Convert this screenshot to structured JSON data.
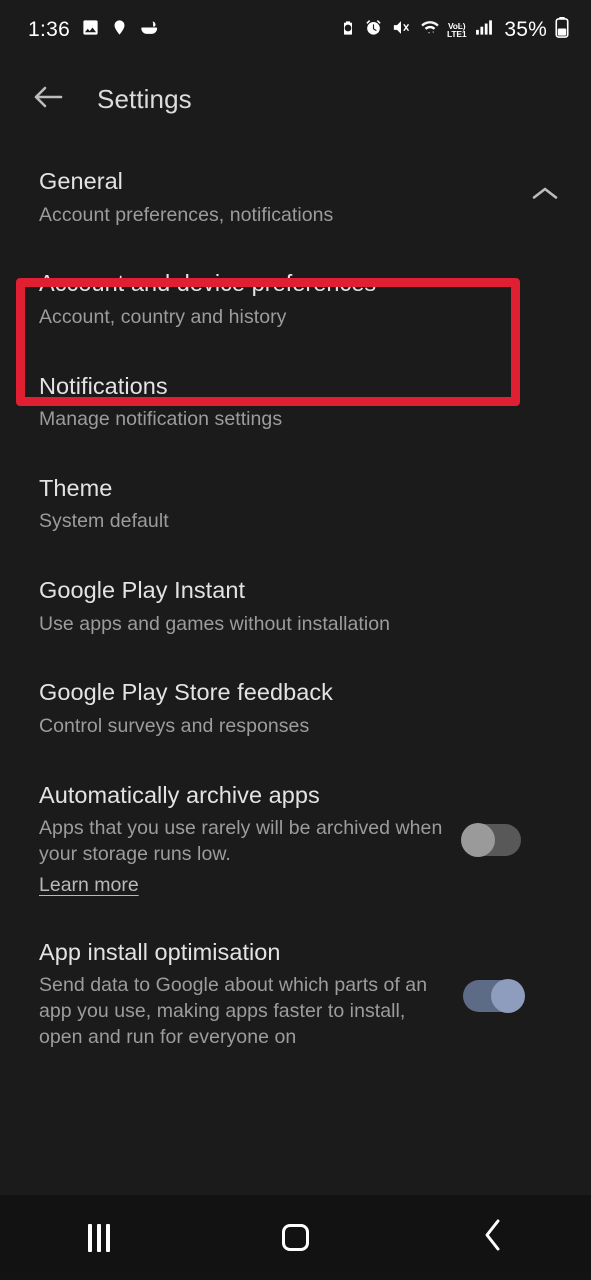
{
  "status_bar": {
    "clock": "1:36",
    "battery_percent": "35%",
    "left_icons": [
      "photo-icon",
      "location-pin-icon",
      "food-bowl-icon"
    ],
    "right_icons": [
      "battery-saver-icon",
      "alarm-icon",
      "mute-icon",
      "wifi-icon",
      "signal-bars-icon",
      "battery-icon"
    ],
    "volte_top": "VoĿ)",
    "volte_bottom": "LTE1"
  },
  "app_bar": {
    "back_icon": "arrow-left-icon",
    "title": "Settings"
  },
  "colors": {
    "background": "#1b1b1b",
    "highlight": "#e01f33",
    "title_text": "#e3e3e3",
    "sub_text": "#9c9c9c",
    "toggle_on": "#8e9dbd",
    "toggle_off": "#9a9a9a"
  },
  "section": {
    "title": "General",
    "subtitle": "Account preferences, notifications",
    "expand_icon": "chevron-up-icon",
    "expanded": true
  },
  "items": [
    {
      "title": "Account and device preferences",
      "subtitle": "Account, country and history",
      "highlighted": true
    },
    {
      "title": "Notifications",
      "subtitle": "Manage notification settings"
    },
    {
      "title": "Theme",
      "subtitle": "System default"
    },
    {
      "title": "Google Play Instant",
      "subtitle": "Use apps and games without installation"
    },
    {
      "title": "Google Play Store feedback",
      "subtitle": "Control surveys and responses"
    },
    {
      "title": "Automatically archive apps",
      "subtitle": "Apps that you use rarely will be archived when your storage runs low.",
      "link": "Learn more",
      "toggle": "off"
    },
    {
      "title": "App install optimisation",
      "subtitle": "Send data to Google about which parts of an app you use, making apps faster to install, open and run for everyone on",
      "toggle": "on"
    }
  ],
  "nav_bar": {
    "recents_icon": "recent-apps-icon",
    "home_icon": "home-icon",
    "back_icon": "chevron-left-icon"
  }
}
